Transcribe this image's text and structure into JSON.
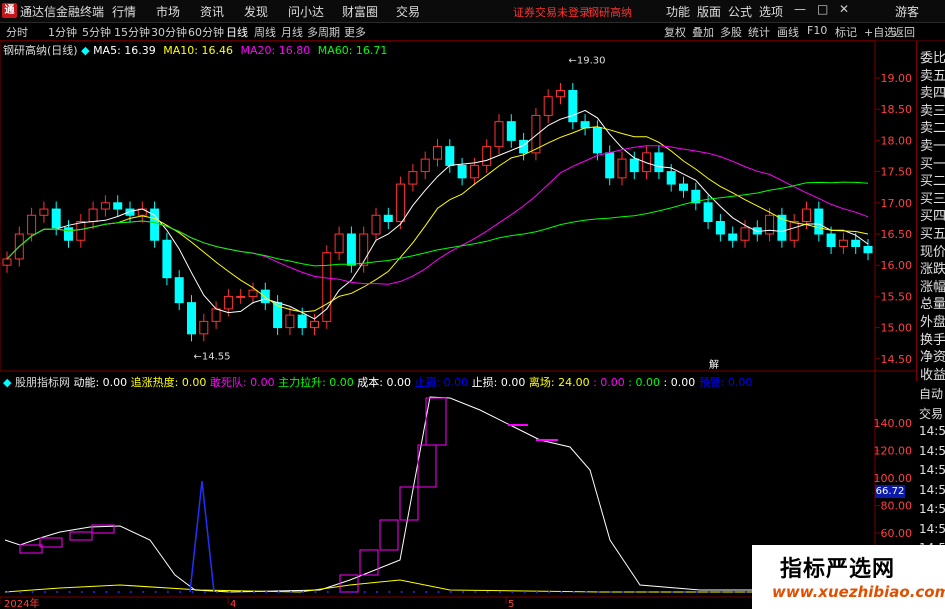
{
  "app": {
    "title": "通达信金融终端",
    "logo": "通"
  },
  "menu": [
    "行情",
    "市场",
    "资讯",
    "发现",
    "问小达",
    "财富圈",
    "交易"
  ],
  "warning": "证券交易未登录",
  "stock_name_top": "钢研高纳",
  "right_menu": [
    "功能",
    "版面",
    "公式",
    "选项"
  ],
  "user": "游客",
  "window_buttons": {
    "min": "—",
    "max": "□",
    "close": "✕"
  },
  "periods": [
    "分时",
    "1分钟",
    "5分钟",
    "15分钟",
    "30分钟",
    "60分钟",
    "日线",
    "周线",
    "月线",
    "多周期",
    "更多"
  ],
  "active_period": "日线",
  "toolbar": [
    "复权",
    "叠加",
    "多股",
    "统计",
    "画线",
    "F10",
    "标记",
    "+自选",
    "返回"
  ],
  "ma_legend": {
    "title": "钢研高纳(日线)",
    "ma5": "MA5: 16.39",
    "ma10": "MA10: 16.46",
    "ma20": "MA20: 16.80",
    "ma60": "MA60: 16.71"
  },
  "price_axis": [
    "19.00",
    "18.50",
    "18.00",
    "17.50",
    "17.00",
    "16.50",
    "16.00",
    "15.50",
    "15.00",
    "14.50"
  ],
  "annotations": {
    "high": "19.30",
    "low": "14.55",
    "mark": "解"
  },
  "indicator_legend": {
    "name": "股朋指标网",
    "items": [
      {
        "text": "动能: 0.00",
        "color": "#ffffff"
      },
      {
        "text": "追涨热度: 0.00",
        "color": "#ffff00"
      },
      {
        "text": "敢死队: 0.00",
        "color": "#ff00ff"
      },
      {
        "text": "主力拉升: 0.00",
        "color": "#00ff00"
      },
      {
        "text": "成本: 0.00",
        "color": "#ffffff"
      },
      {
        "text": "止赢: 0.00",
        "color": "#0000ff"
      },
      {
        "text": "止损: 0.00",
        "color": "#ffffff"
      },
      {
        "text": "离场: 24.00",
        "color": "#ffff00"
      },
      {
        "text": ": 0.00",
        "color": "#ff00ff"
      },
      {
        "text": ": 0.00",
        "color": "#00ff00"
      },
      {
        "text": ": 0.00",
        "color": "#ffffff"
      },
      {
        "text": "预警: 0.00",
        "color": "#0000ff"
      }
    ]
  },
  "indicator_axis": [
    "140.00",
    "120.00",
    "100.00",
    "80.00",
    "60.00",
    "40.00",
    "20.00"
  ],
  "indicator_value_badge": "66.72",
  "date_axis": [
    "2024年",
    "4",
    "5"
  ],
  "right_panel": [
    "委比",
    "卖五",
    "卖四",
    "卖三",
    "卖二",
    "卖一",
    "买一",
    "买二",
    "买三",
    "买四",
    "买五",
    "现价",
    "涨跌",
    "涨幅",
    "总量",
    "外盘",
    "换手",
    "净资",
    "收益"
  ],
  "right_panel2": [
    "自动",
    "交易",
    "14:56",
    "14:56",
    "14:56",
    "14:56",
    "14:56",
    "14:56",
    "14:56",
    "14:56",
    "14:56"
  ],
  "watermark": {
    "line1": "指标严选网",
    "line2": "www.xuezhibiao.com"
  },
  "colors": {
    "up": "#ff3232",
    "down": "#00ffff",
    "ma5": "#ffffff",
    "ma10": "#ffff00",
    "ma20": "#ff00ff",
    "ma60": "#00ff00"
  }
}
